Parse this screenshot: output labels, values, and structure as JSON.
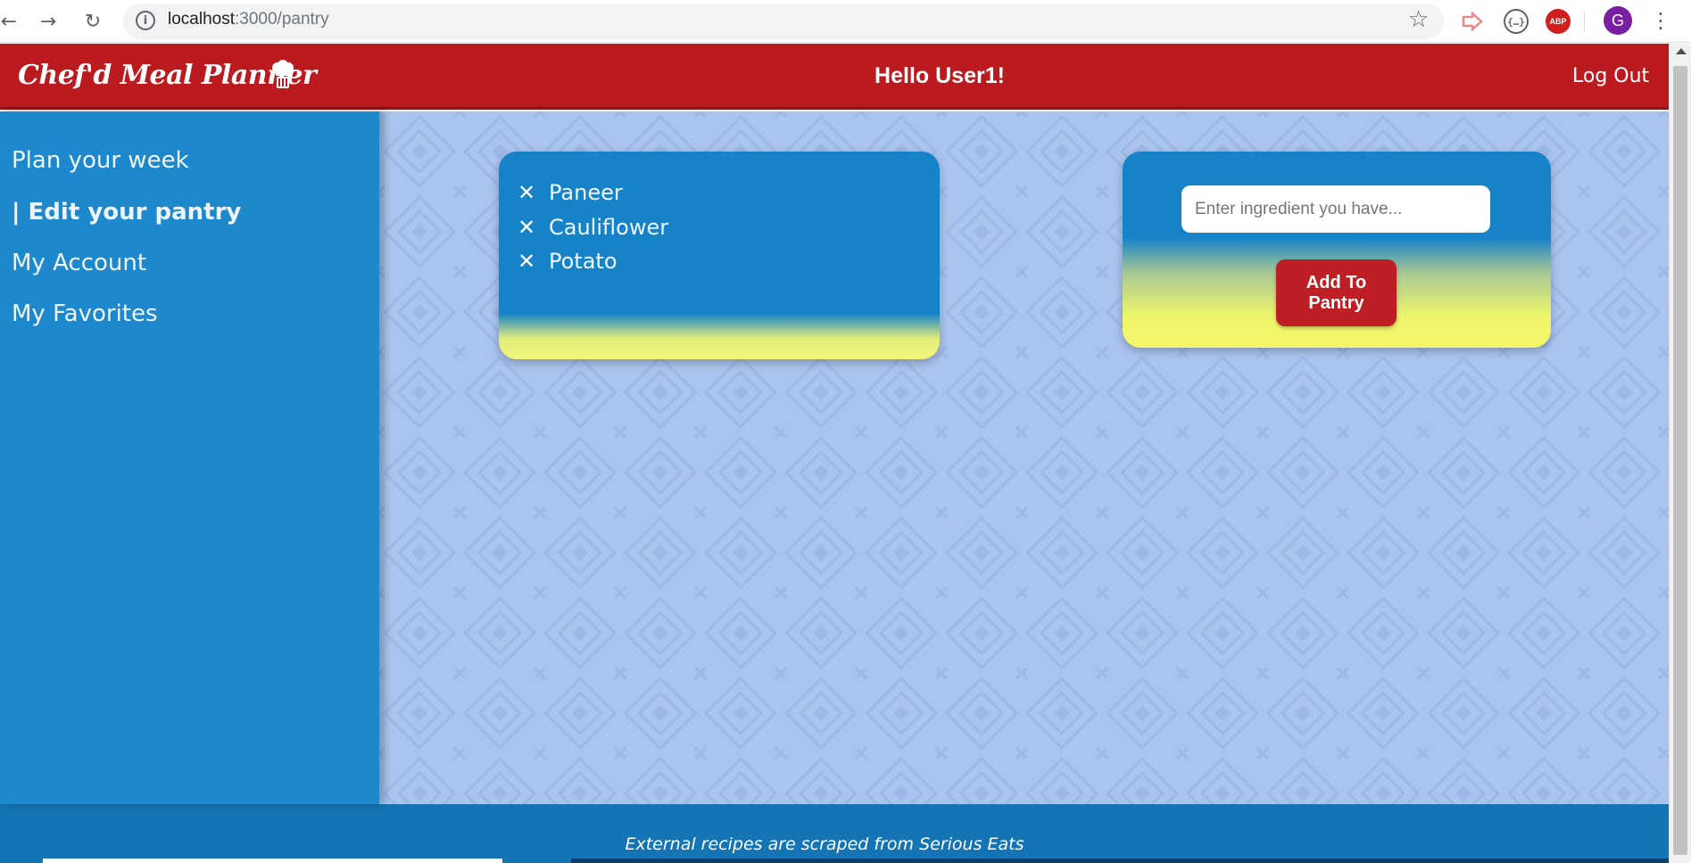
{
  "browser": {
    "url_host": "localhost",
    "url_path": ":3000/pantry",
    "profile_initial": "G",
    "ext_3_label": "ABP",
    "ext_2_label": "{…}",
    "icons": [
      "back-arrow-icon",
      "forward-arrow-icon",
      "reload-icon",
      "info-icon",
      "star-icon",
      "extension-icon",
      "json-viewer-icon",
      "adblock-icon",
      "menu-dots-icon"
    ]
  },
  "header": {
    "brand": "Chef'd Meal Planner",
    "greeting": "Hello User1!",
    "logout_label": "Log Out",
    "background_color": "#bb1a1f"
  },
  "sidebar": {
    "items": [
      {
        "label": "Plan your week",
        "active": false
      },
      {
        "label": "| Edit your pantry",
        "active": true
      },
      {
        "label": "My Account",
        "active": false
      },
      {
        "label": "My Favorites",
        "active": false
      }
    ],
    "background_color": "#1e88cc"
  },
  "pantry": {
    "items": [
      {
        "name": "Paneer"
      },
      {
        "name": "Cauliflower"
      },
      {
        "name": "Potato"
      }
    ],
    "input_placeholder": "Enter ingredient you have...",
    "input_value": "",
    "add_button_label": "Add To\nPantry"
  },
  "footer": {
    "text": "External recipes are scraped from Serious Eats"
  }
}
